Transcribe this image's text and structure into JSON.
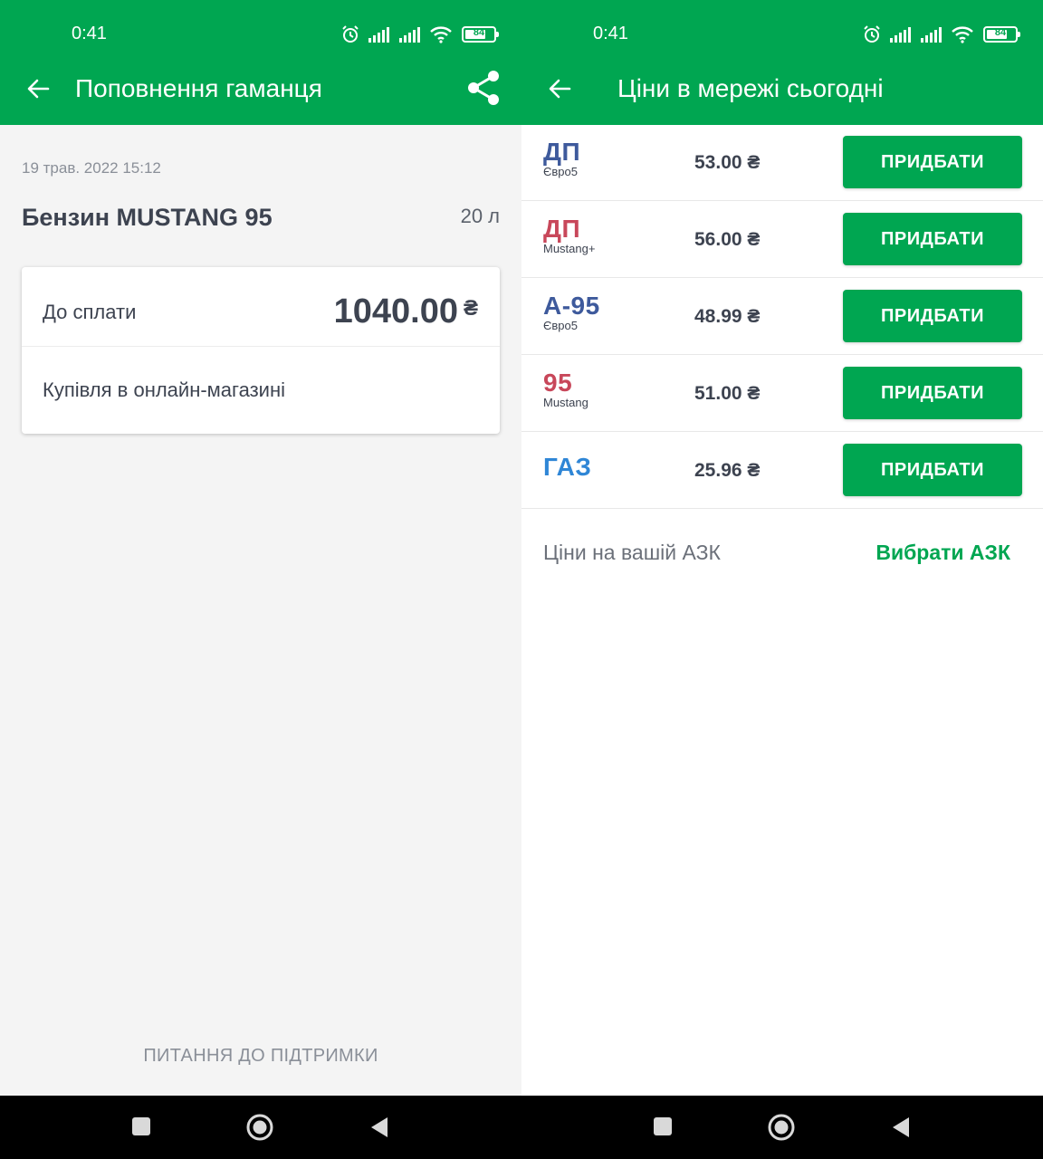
{
  "status_bar": {
    "time": "0:41",
    "battery": "84"
  },
  "left_screen": {
    "title": "Поповнення гаманця",
    "date": "19 трав. 2022 15:12",
    "product_name": "Бензин MUSTANG 95",
    "volume": "20 л",
    "pay_label": "До сплати",
    "pay_amount": "1040.00",
    "currency": "₴",
    "purchase_method": "Купівля в онлайн-магазині",
    "support_link": "ПИТАННЯ ДО ПІДТРИМКИ"
  },
  "right_screen": {
    "title": "Ціни в мережі сьогодні",
    "fuels": [
      {
        "name": "ДП",
        "sub": "Євро5",
        "color": "#3e5a9c",
        "price": "53.00 ₴",
        "button": "ПРИДБАТИ"
      },
      {
        "name": "ДП",
        "sub": "Mustang+",
        "color": "#c8475a",
        "price": "56.00 ₴",
        "button": "ПРИДБАТИ"
      },
      {
        "name": "А-95",
        "sub": "Євро5",
        "color": "#3e5a9c",
        "price": "48.99 ₴",
        "button": "ПРИДБАТИ"
      },
      {
        "name": "95",
        "sub": "Mustang",
        "color": "#c8475a",
        "price": "51.00 ₴",
        "button": "ПРИДБАТИ"
      },
      {
        "name": "ГАЗ",
        "sub": "",
        "color": "#2f86d6",
        "price": "25.96 ₴",
        "button": "ПРИДБАТИ"
      }
    ],
    "station_label": "Ціни на вашій АЗК",
    "station_link": "Вибрати АЗК"
  },
  "icons": {
    "back": "arrow-left-icon",
    "share": "share-icon",
    "alarm": "alarm-icon",
    "signal": "signal-icon",
    "wifi": "wifi-icon",
    "nav_recents": "square-icon",
    "nav_home": "circle-icon",
    "nav_back": "triangle-back-icon"
  },
  "colors": {
    "brand_green": "#00a651",
    "text_dark": "#3d4350",
    "bg_light": "#f4f4f4"
  }
}
